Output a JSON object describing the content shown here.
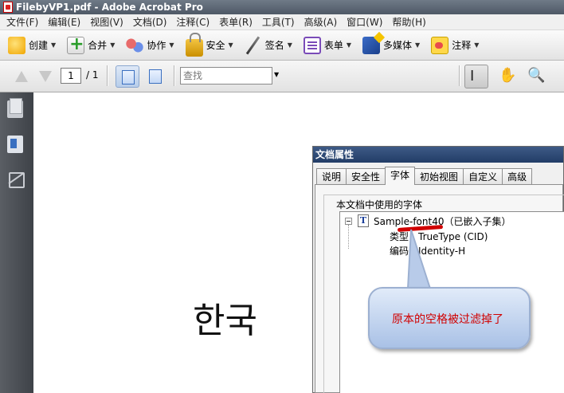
{
  "window": {
    "title": "FilebyVP1.pdf - Adobe Acrobat Pro"
  },
  "menu": [
    "文件(F)",
    "编辑(E)",
    "视图(V)",
    "文档(D)",
    "注释(C)",
    "表单(R)",
    "工具(T)",
    "高级(A)",
    "窗口(W)",
    "帮助(H)"
  ],
  "toolbar": {
    "create": "创建",
    "combine": "合并",
    "collaborate": "协作",
    "secure": "安全",
    "sign": "签名",
    "forms": "表单",
    "multimedia": "多媒体",
    "comment": "注释"
  },
  "navigation": {
    "page_current": "1",
    "page_total": "/ 1",
    "search_value": "查找"
  },
  "document": {
    "korean_text": "한국"
  },
  "dialog": {
    "title": "文档属性",
    "tabs": [
      "说明",
      "安全性",
      "字体",
      "初始视图",
      "自定义",
      "高级"
    ],
    "active_tab": "字体",
    "group_title": "本文档中使用的字体",
    "font": {
      "name": "Sample-font40（已嵌入子集）",
      "type": "类型：TrueType (CID)",
      "encoding": "编码：Identity-H"
    }
  },
  "callout": {
    "text": "原本的空格被过滤掉了"
  },
  "colors": {
    "annotation_red": "#d10000",
    "title_bar": "#223d67"
  }
}
